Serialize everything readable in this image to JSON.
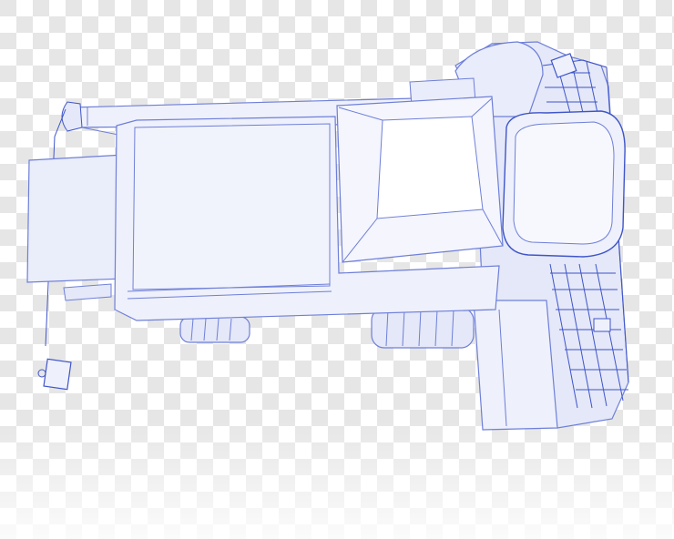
{
  "image": {
    "subject": "combine-harvester-3d-model-top-view",
    "style": "blueprint-xray-render",
    "background": "transparency-checkerboard"
  },
  "colors": {
    "checker_light": "#ffffff",
    "checker_dark": "#e6e6e6",
    "body_fill": "#eef0fb",
    "body_fill_mid": "#e4e8f8",
    "body_fill_dark": "#d5dbf3",
    "stroke": "#6e7fd8",
    "stroke_strong": "#3f55c9",
    "shadow": "#dfe3f5"
  }
}
